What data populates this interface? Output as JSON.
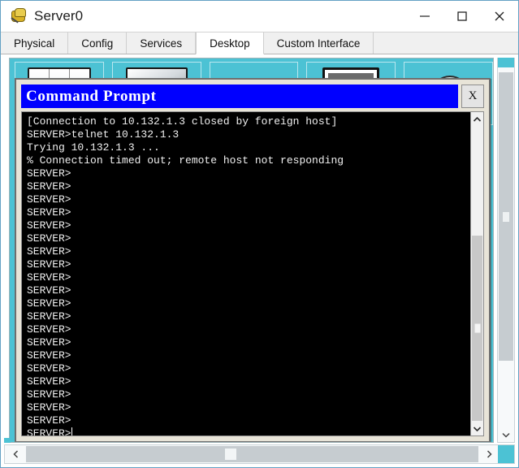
{
  "window": {
    "title": "Server0",
    "icon": "packet-tracer-icon",
    "controls": {
      "minimize": "minimize-icon",
      "maximize": "maximize-icon",
      "close": "close-icon"
    }
  },
  "tabs": [
    {
      "label": "Physical",
      "active": false
    },
    {
      "label": "Config",
      "active": false
    },
    {
      "label": "Services",
      "active": false
    },
    {
      "label": "Desktop",
      "active": true
    },
    {
      "label": "Custom Interface",
      "active": false
    }
  ],
  "desktop": {
    "background_color": "#4cc2d4",
    "icons": [
      {
        "name": "books-icon"
      },
      {
        "name": "monitor-icon"
      },
      {
        "name": "page-icon"
      },
      {
        "name": "terminal-icon"
      },
      {
        "name": "cloud-icon"
      }
    ]
  },
  "command_prompt": {
    "title": "Command Prompt",
    "title_bar_color": "#0000ff",
    "title_text_color": "#ffffff",
    "close_label": "X",
    "terminal_background": "#000000",
    "terminal_text_color": "#f0f0f0",
    "lines": [
      "[Connection to 10.132.1.3 closed by foreign host]",
      "SERVER>telnet 10.132.1.3",
      "Trying 10.132.1.3 ...",
      "% Connection timed out; remote host not responding",
      "SERVER>",
      "SERVER>",
      "SERVER>",
      "SERVER>",
      "SERVER>",
      "SERVER>",
      "SERVER>",
      "SERVER>",
      "SERVER>",
      "SERVER>",
      "SERVER>",
      "SERVER>",
      "SERVER>",
      "SERVER>",
      "SERVER>",
      "SERVER>",
      "SERVER>",
      "SERVER>",
      "SERVER>",
      "SERVER>"
    ],
    "prompt_line": "SERVER>",
    "cursor_visible": true
  },
  "scrollbars": {
    "terminal_vertical": {
      "up_arrow": "chevron-up-icon",
      "down_arrow": "chevron-down-icon"
    },
    "panel_vertical": {
      "up_arrow": "chevron-up-icon",
      "down_arrow": "chevron-down-icon"
    },
    "panel_horizontal": {
      "left_arrow": "chevron-left-icon",
      "right_arrow": "chevron-right-icon"
    }
  }
}
